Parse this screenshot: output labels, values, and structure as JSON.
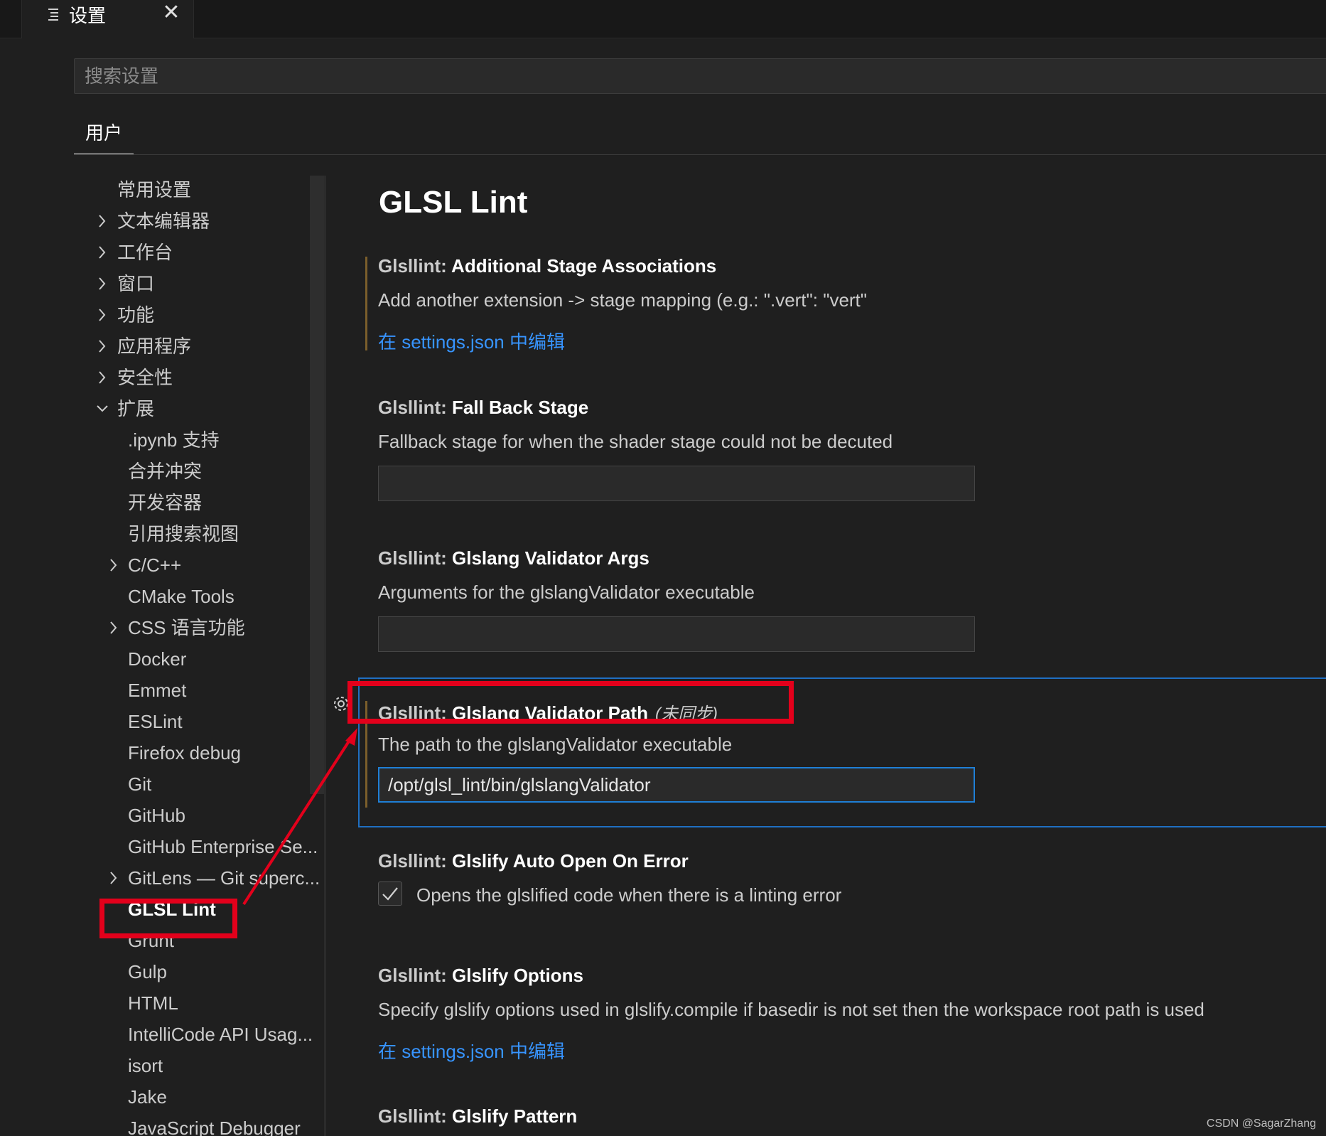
{
  "tab": {
    "label": "设置",
    "close": "✕",
    "icon": "settings-file-icon"
  },
  "search": {
    "placeholder": "搜索设置"
  },
  "scope_tab": "用户",
  "toc": [
    {
      "label": "常用设置",
      "chevron": "",
      "indent": 0
    },
    {
      "label": "文本编辑器",
      "chevron": "right",
      "indent": 0
    },
    {
      "label": "工作台",
      "chevron": "right",
      "indent": 0
    },
    {
      "label": "窗口",
      "chevron": "right",
      "indent": 0
    },
    {
      "label": "功能",
      "chevron": "right",
      "indent": 0
    },
    {
      "label": "应用程序",
      "chevron": "right",
      "indent": 0
    },
    {
      "label": "安全性",
      "chevron": "right",
      "indent": 0
    },
    {
      "label": "扩展",
      "chevron": "down",
      "indent": 0
    },
    {
      "label": ".ipynb 支持",
      "chevron": "",
      "indent": 1
    },
    {
      "label": "合并冲突",
      "chevron": "",
      "indent": 1
    },
    {
      "label": "开发容器",
      "chevron": "",
      "indent": 1
    },
    {
      "label": "引用搜索视图",
      "chevron": "",
      "indent": 1
    },
    {
      "label": "C/C++",
      "chevron": "right",
      "indent": 1
    },
    {
      "label": "CMake Tools",
      "chevron": "",
      "indent": 1
    },
    {
      "label": "CSS 语言功能",
      "chevron": "right",
      "indent": 1
    },
    {
      "label": "Docker",
      "chevron": "",
      "indent": 1
    },
    {
      "label": "Emmet",
      "chevron": "",
      "indent": 1
    },
    {
      "label": "ESLint",
      "chevron": "",
      "indent": 1
    },
    {
      "label": "Firefox debug",
      "chevron": "",
      "indent": 1
    },
    {
      "label": "Git",
      "chevron": "",
      "indent": 1
    },
    {
      "label": "GitHub",
      "chevron": "",
      "indent": 1
    },
    {
      "label": "GitHub Enterprise Se...",
      "chevron": "",
      "indent": 1
    },
    {
      "label": "GitLens — Git superc...",
      "chevron": "right",
      "indent": 1
    },
    {
      "label": "GLSL Lint",
      "chevron": "",
      "indent": 1,
      "active": true
    },
    {
      "label": "Grunt",
      "chevron": "",
      "indent": 1
    },
    {
      "label": "Gulp",
      "chevron": "",
      "indent": 1
    },
    {
      "label": "HTML",
      "chevron": "",
      "indent": 1
    },
    {
      "label": "IntelliCode API Usag...",
      "chevron": "",
      "indent": 1
    },
    {
      "label": "isort",
      "chevron": "",
      "indent": 1
    },
    {
      "label": "Jake",
      "chevron": "",
      "indent": 1
    },
    {
      "label": "JavaScript Debugger",
      "chevron": "",
      "indent": 1
    }
  ],
  "page_title": "GLSL Lint",
  "settings": {
    "s1": {
      "category": "Glsllint: ",
      "key": "Additional Stage Associations",
      "desc": "Add another extension -> stage mapping (e.g.: \".vert\": \"vert\"",
      "link": "在 settings.json 中编辑"
    },
    "s2": {
      "category": "Glsllint: ",
      "key": "Fall Back Stage",
      "desc": "Fallback stage for when the shader stage could not be decuted",
      "value": ""
    },
    "s3": {
      "category": "Glsllint: ",
      "key": "Glslang Validator Args",
      "desc": "Arguments for the glslangValidator executable",
      "value": ""
    },
    "s4": {
      "category": "Glsllint: ",
      "key": "Glslang Validator Path",
      "modifier": "(未同步)",
      "desc": "The path to the glslangValidator executable",
      "value": "/opt/glsl_lint/bin/glslangValidator"
    },
    "s5": {
      "category": "Glsllint: ",
      "key": "Glslify Auto Open On Error",
      "desc": "Opens the glslified code when there is a linting error",
      "checked": true
    },
    "s6": {
      "category": "Glsllint: ",
      "key": "Glslify Options",
      "desc": "Specify glslify options used in glslify.compile if basedir is not set then the workspace root path is used",
      "link": "在 settings.json 中编辑"
    },
    "s7": {
      "category": "Glsllint: ",
      "key": "Glslify Pattern"
    }
  },
  "colors": {
    "accent": "#3794ff",
    "annotation": "#e3001b",
    "focus": "#1f6fc2",
    "modified_bar": "#7b5e2b"
  },
  "watermark": "CSDN @SagarZhang"
}
